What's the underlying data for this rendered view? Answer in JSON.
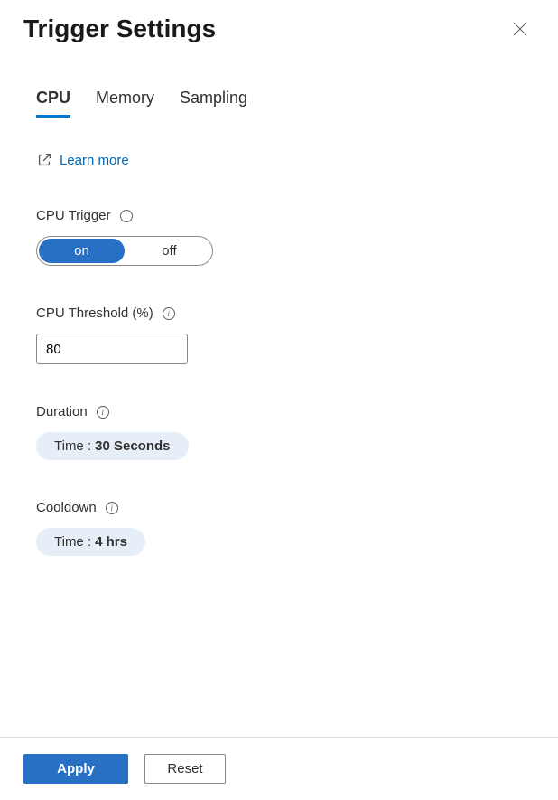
{
  "header": {
    "title": "Trigger Settings"
  },
  "tabs": [
    {
      "label": "CPU",
      "active": true
    },
    {
      "label": "Memory",
      "active": false
    },
    {
      "label": "Sampling",
      "active": false
    }
  ],
  "learnMore": {
    "label": "Learn more"
  },
  "cpuTrigger": {
    "label": "CPU Trigger",
    "options": {
      "on": "on",
      "off": "off"
    },
    "value": "on"
  },
  "cpuThreshold": {
    "label": "CPU Threshold (%)",
    "value": "80"
  },
  "duration": {
    "label": "Duration",
    "prefix": "Time :",
    "value": "30 Seconds"
  },
  "cooldown": {
    "label": "Cooldown",
    "prefix": "Time :",
    "value": "4 hrs"
  },
  "footer": {
    "apply": "Apply",
    "reset": "Reset"
  }
}
